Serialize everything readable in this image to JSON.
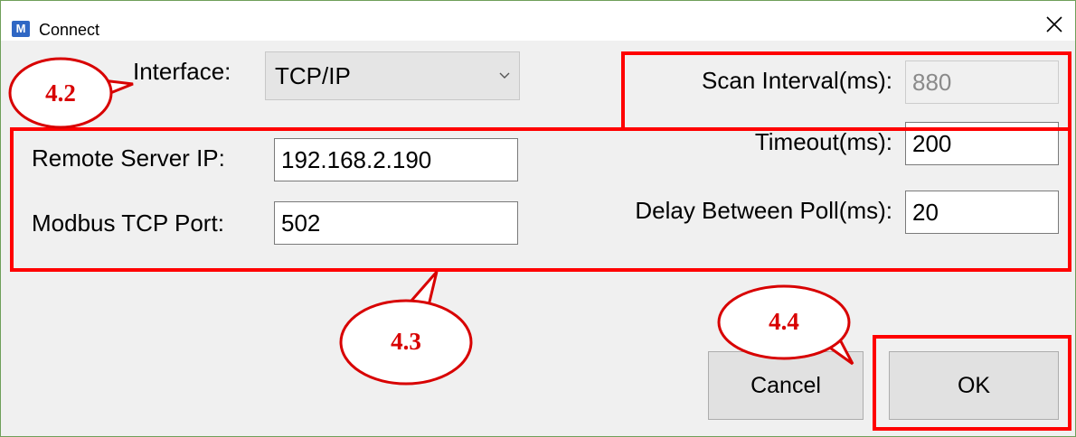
{
  "window": {
    "title": "Connect",
    "app_icon_letter": "M",
    "close_glyph": "✕"
  },
  "form": {
    "interface_label": "Interface:",
    "interface_value": "TCP/IP",
    "scan_interval_label": "Scan Interval(ms):",
    "scan_interval_value": "880",
    "timeout_label": "Timeout(ms):",
    "timeout_value": "200",
    "delay_label": "Delay Between Poll(ms):",
    "delay_value": "20",
    "remote_ip_label": "Remote Server IP:",
    "remote_ip_value": "192.168.2.190",
    "port_label": "Modbus TCP Port:",
    "port_value": "502"
  },
  "buttons": {
    "cancel_label": "Cancel",
    "ok_label": "OK"
  },
  "annotations": {
    "callout_1": "4.2",
    "callout_2": "4.3",
    "callout_3": "4.4"
  },
  "colors": {
    "highlight": "#ff0000",
    "callout_text": "#d80000",
    "accent": "#2f67c4"
  }
}
